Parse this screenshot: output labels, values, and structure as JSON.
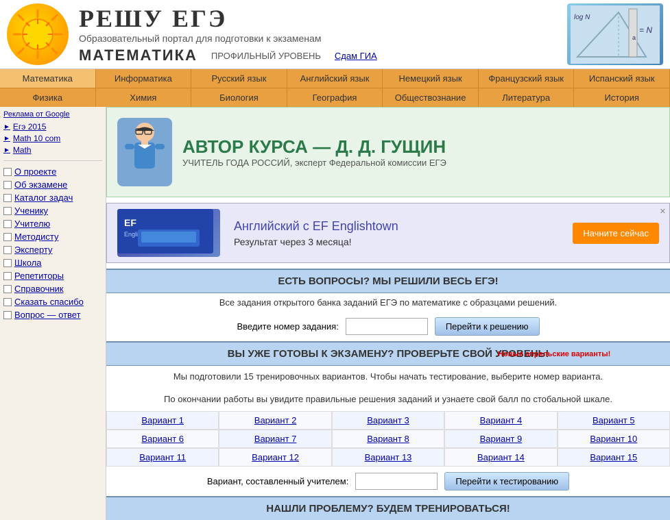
{
  "header": {
    "title": "РЕШУ ЕГЭ",
    "subtitle": "Образовательный портал для подготовки к экзаменам",
    "subject": "МАТЕМАТИКА",
    "level": "ПРОФИЛЬНЫЙ УРОВЕНЬ",
    "gia_link": "Сдам ГИА"
  },
  "nav_row1": [
    "Математика",
    "Информатика",
    "Русский язык",
    "Английский язык",
    "Немецкий язык",
    "Французский язык",
    "Испанский язык"
  ],
  "nav_row2": [
    "Физика",
    "Химия",
    "Биология",
    "География",
    "Обществознание",
    "Литература",
    "История"
  ],
  "sidebar": {
    "ad_label": "Реклама от Google",
    "ad_items": [
      "Егэ 2015",
      "Math 10 com",
      "Math"
    ],
    "links": [
      "О проекте",
      "Об экзамене",
      "Каталог задач",
      "Ученику",
      "Учителю",
      "Методисту",
      "Эксперту",
      "Школа",
      "Репетиторы",
      "Справочник",
      "Сказать спасибо",
      "Вопрос — ответ"
    ]
  },
  "author_banner": {
    "title": "АВТОР КУРСА — Д. Д. ГУЩИН",
    "subtitle": "УЧИТЕЛЬ ГОДА РОССИЙ, эксперт Федеральной комиссии ЕГЭ"
  },
  "ef_banner": {
    "title": "Английский с EF Englishtown",
    "subtitle": "Результат через 3 месяца!",
    "button": "Начните сейчас"
  },
  "section1": {
    "header": "ЕСТЬ ВОПРОСЫ? МЫ РЕШИЛИ ВЕСЬ ЕГЭ!",
    "text": "Все задания открытого банка заданий ЕГЭ по математике с образцами решений.",
    "input_label": "Введите номер задания:",
    "button": "Перейти к решению"
  },
  "section2": {
    "header": "ВЫ УЖЕ ГОТОВЫ К ЭКЗАМЕНУ? ПРОВЕРЬТЕ СВОЙ УРОВЕНЬ!",
    "new_badge": "Новые апрельские варианты!",
    "desc1": "Мы подготовили 15 тренировочных вариантов. Чтобы начать тестирование, выберите номер варианта.",
    "desc2": "По окончании работы вы увидите правильные решения заданий и узнаете свой балл по стобальной шкале.",
    "variants": [
      [
        "Вариант 1",
        "Вариант 2",
        "Вариант 3",
        "Вариант 4",
        "Вариант 5"
      ],
      [
        "Вариант 6",
        "Вариант 7",
        "Вариант 8",
        "Вариант 9",
        "Вариант 10"
      ],
      [
        "Вариант 11",
        "Вариант 12",
        "Вариант 13",
        "Вариант 14",
        "Вариант 15"
      ]
    ],
    "teacher_label": "Вариант, составленный учителем:",
    "teacher_button": "Перейти к тестированию"
  },
  "section3": {
    "header": "НАШЛИ ПРОБЛЕМУ? БУДЕМ ТРЕНИРОВАТЬСЯ!"
  }
}
